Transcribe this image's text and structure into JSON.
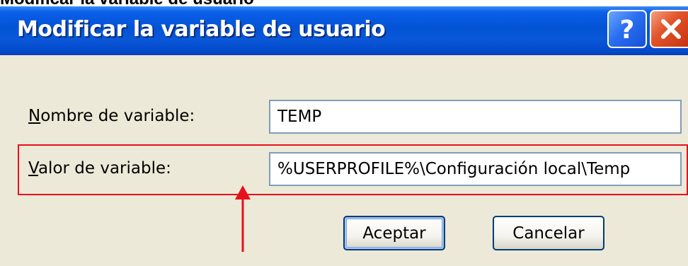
{
  "caption": "Modificar la variable de usuario",
  "window": {
    "title": "Modificar la variable de usuario",
    "help_glyph": "?",
    "close_glyph": "close-icon"
  },
  "form": {
    "nombre": {
      "label_mnemonic": "N",
      "label_rest": "ombre de variable:",
      "value": "TEMP"
    },
    "valor": {
      "label_mnemonic": "V",
      "label_rest": "alor de variable:",
      "value": "%USERPROFILE%\\Configuración local\\Temp"
    }
  },
  "buttons": {
    "ok_label": "Aceptar",
    "cancel_label": "Cancelar"
  },
  "annotation": {
    "highlight_color": "#e8101c",
    "arrow_color": "#e8101c"
  }
}
